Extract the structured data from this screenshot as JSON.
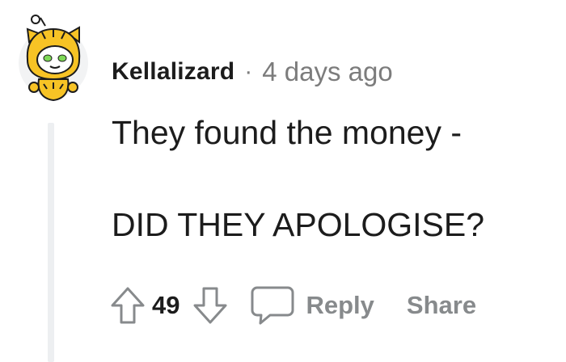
{
  "comment": {
    "author": "Kellalizard",
    "separator": "·",
    "timestamp": "4 days ago",
    "body_lines": [
      "They found the money -",
      "DID THEY APOLOGISE?"
    ],
    "score": "49",
    "reply_label": "Reply",
    "share_label": "Share"
  },
  "colors": {
    "text": "#1c1c1c",
    "meta": "#7c7c7c",
    "action": "#878a8c",
    "thread_line": "#edeff1",
    "avatar_yellow": "#f7c325",
    "avatar_eyes": "#7ed957"
  },
  "icons": {
    "avatar": "snoo-tiger-avatar",
    "upvote": "arrow-up-outline-icon",
    "downvote": "arrow-down-outline-icon",
    "reply": "speech-bubble-icon"
  }
}
